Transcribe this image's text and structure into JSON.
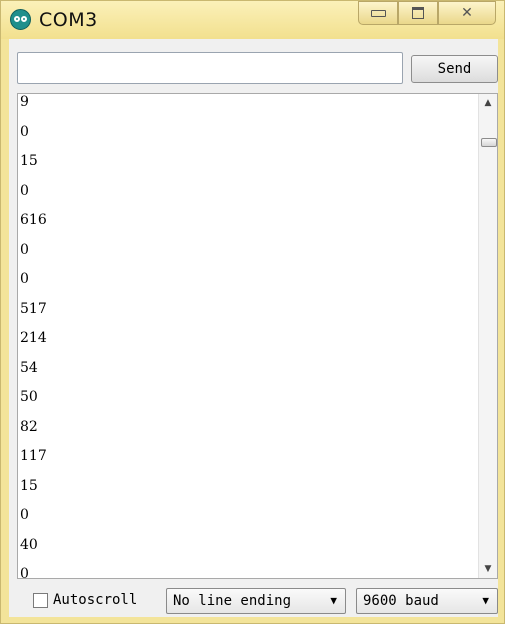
{
  "window": {
    "title": "COM3",
    "icon": "arduino-icon"
  },
  "toolbar": {
    "input_value": "",
    "input_placeholder": "",
    "send_label": "Send"
  },
  "output_lines": [
    "9",
    "0",
    "15",
    "0",
    "616",
    "0",
    "0",
    "517",
    "214",
    "54",
    "50",
    "82",
    "117",
    "15",
    "0",
    "40",
    "0"
  ],
  "footer": {
    "autoscroll_label": "Autoscroll",
    "autoscroll_checked": false,
    "line_ending_value": "No line ending",
    "baud_value": "9600 baud"
  },
  "colors": {
    "titlebar": "#f2e08e",
    "accent": "#1f8f8c"
  }
}
